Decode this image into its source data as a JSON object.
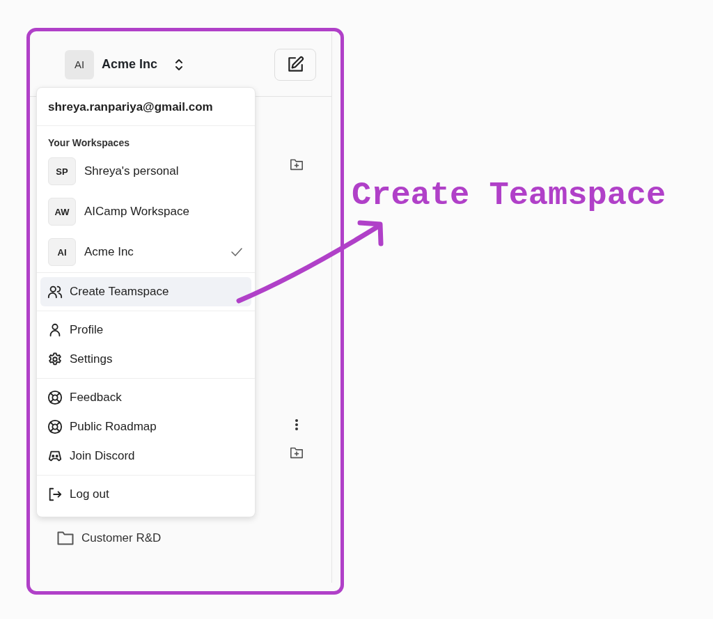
{
  "sidebar": {
    "workspace_switcher": {
      "initials": "AI",
      "name": "Acme Inc"
    },
    "folders": [
      {
        "label": "Customer R&D"
      }
    ]
  },
  "menu": {
    "email": "shreya.ranpariya@gmail.com",
    "section_title": "Your Workspaces",
    "workspaces": [
      {
        "initials": "SP",
        "name": "Shreya's personal",
        "selected": false
      },
      {
        "initials": "AW",
        "name": "AICamp Workspace",
        "selected": false
      },
      {
        "initials": "AI",
        "name": "Acme Inc",
        "selected": true
      }
    ],
    "groups": [
      [
        {
          "label": "Create Teamspace",
          "kind": "team",
          "highlighted": true
        }
      ],
      [
        {
          "label": "Profile",
          "kind": "profile",
          "highlighted": false
        },
        {
          "label": "Settings",
          "kind": "settings",
          "highlighted": false
        }
      ],
      [
        {
          "label": "Feedback",
          "kind": "help",
          "highlighted": false
        },
        {
          "label": "Public Roadmap",
          "kind": "help",
          "highlighted": false
        },
        {
          "label": "Join Discord",
          "kind": "community",
          "highlighted": false
        }
      ],
      [
        {
          "label": "Log out",
          "kind": "logout",
          "highlighted": false
        }
      ]
    ]
  },
  "annotation": {
    "text": "Create Teamspace"
  }
}
